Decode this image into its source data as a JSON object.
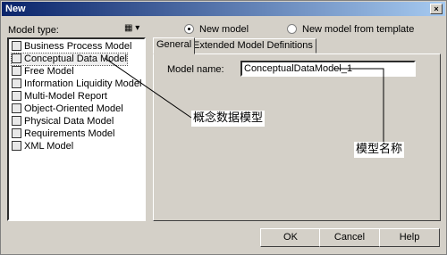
{
  "window": {
    "title": "New",
    "close_glyph": "×"
  },
  "model_type_label": "Model type:",
  "view_button_glyph": "▦ ▾",
  "model_types": [
    {
      "label": "Business Process Model",
      "icon": "business-process-icon"
    },
    {
      "label": "Conceptual Data Model",
      "icon": "conceptual-data-icon",
      "selected": true
    },
    {
      "label": "Free Model",
      "icon": "free-model-icon"
    },
    {
      "label": "Information Liquidity Model",
      "icon": "information-liquidity-icon"
    },
    {
      "label": "Multi-Model Report",
      "icon": "report-icon"
    },
    {
      "label": "Object-Oriented Model",
      "icon": "object-oriented-icon"
    },
    {
      "label": "Physical Data Model",
      "icon": "physical-data-icon"
    },
    {
      "label": "Requirements Model",
      "icon": "requirements-icon"
    },
    {
      "label": "XML Model",
      "icon": "xml-icon"
    }
  ],
  "radios": {
    "new_model": "New model",
    "new_from_template": "New model from template",
    "selected": "new_model"
  },
  "tabs": {
    "general": "General",
    "extended": "Extended Model Definitions",
    "active": "general"
  },
  "model_name_label": "Model name:",
  "model_name_value": "ConceptualDataModel_1",
  "buttons": {
    "ok": "OK",
    "cancel": "Cancel",
    "help": "Help"
  },
  "annotations": {
    "left": "概念数据模型",
    "right": "模型名称"
  }
}
